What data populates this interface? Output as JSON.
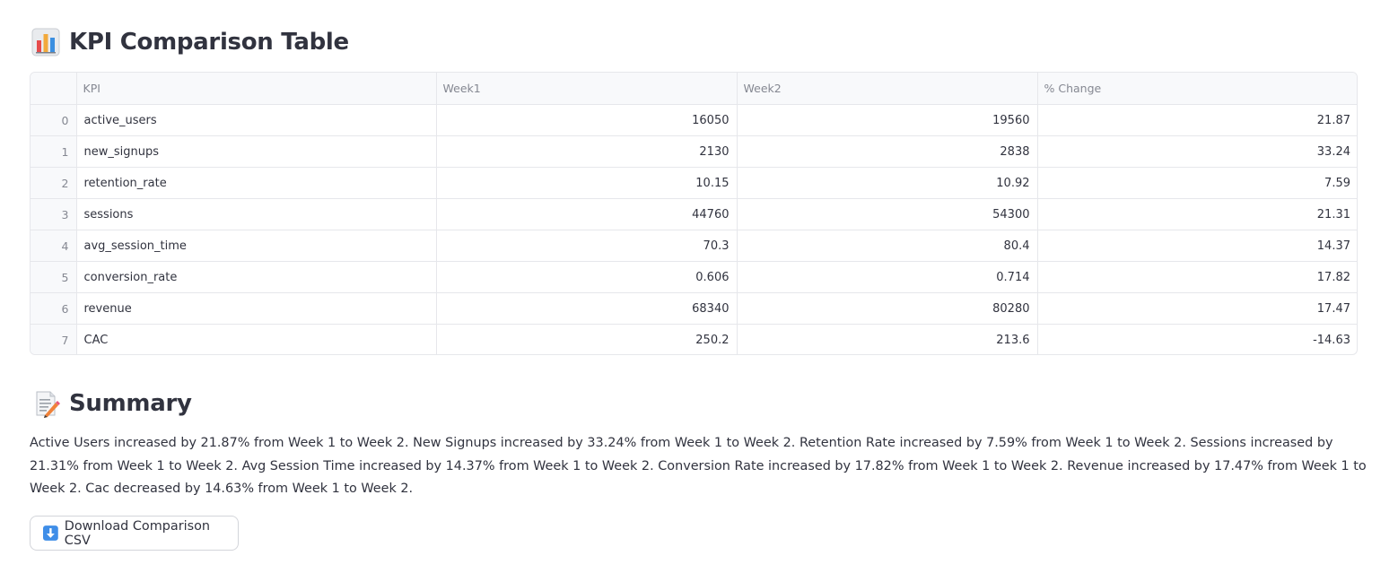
{
  "kpi_section": {
    "title": "KPI Comparison Table",
    "icon": "bar-chart-icon"
  },
  "table": {
    "columns": [
      "",
      "KPI",
      "Week1",
      "Week2",
      "% Change"
    ],
    "rows": [
      {
        "index": "0",
        "kpi": "active_users",
        "week1": "16050",
        "week2": "19560",
        "pct_change": "21.87"
      },
      {
        "index": "1",
        "kpi": "new_signups",
        "week1": "2130",
        "week2": "2838",
        "pct_change": "33.24"
      },
      {
        "index": "2",
        "kpi": "retention_rate",
        "week1": "10.15",
        "week2": "10.92",
        "pct_change": "7.59"
      },
      {
        "index": "3",
        "kpi": "sessions",
        "week1": "44760",
        "week2": "54300",
        "pct_change": "21.31"
      },
      {
        "index": "4",
        "kpi": "avg_session_time",
        "week1": "70.3",
        "week2": "80.4",
        "pct_change": "14.37"
      },
      {
        "index": "5",
        "kpi": "conversion_rate",
        "week1": "0.606",
        "week2": "0.714",
        "pct_change": "17.82"
      },
      {
        "index": "6",
        "kpi": "revenue",
        "week1": "68340",
        "week2": "80280",
        "pct_change": "17.47"
      },
      {
        "index": "7",
        "kpi": "CAC",
        "week1": "250.2",
        "week2": "213.6",
        "pct_change": "-14.63"
      }
    ]
  },
  "summary_section": {
    "title": "Summary",
    "icon": "memo-icon",
    "text": "Active Users increased by 21.87% from Week 1 to Week 2. New Signups increased by 33.24% from Week 1 to Week 2. Retention Rate increased by 7.59% from Week 1 to Week 2. Sessions increased by 21.31% from Week 1 to Week 2. Avg Session Time increased by 14.37% from Week 1 to Week 2. Conversion Rate increased by 17.82% from Week 1 to Week 2. Revenue increased by 17.47% from Week 1 to Week 2. Cac decreased by 14.63% from Week 1 to Week 2."
  },
  "download_button": {
    "label": "Download Comparison CSV",
    "icon": "down-arrow-icon"
  }
}
